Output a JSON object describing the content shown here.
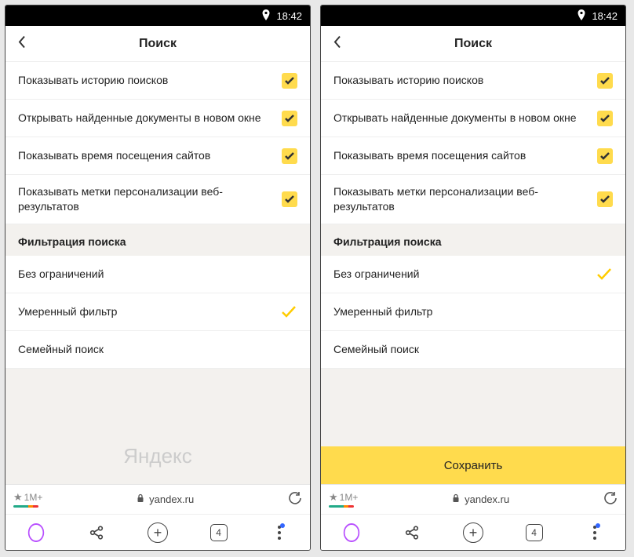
{
  "status": {
    "time": "18:42"
  },
  "header": {
    "title": "Поиск"
  },
  "options": [
    {
      "label": "Показывать историю поисков",
      "checked": true
    },
    {
      "label": "Открывать найденные документы в новом окне",
      "checked": true
    },
    {
      "label": "Показывать время посещения сайтов",
      "checked": true
    },
    {
      "label": "Показывать метки персонализации веб-результатов",
      "checked": true
    }
  ],
  "filter": {
    "title": "Фильтрация поиска",
    "items": [
      {
        "label": "Без ограничений"
      },
      {
        "label": "Умеренный фильтр"
      },
      {
        "label": "Семейный поиск"
      }
    ]
  },
  "screens": {
    "left": {
      "selected_filter_index": 1,
      "footer_kind": "brand",
      "brand": "Яндекс"
    },
    "right": {
      "selected_filter_index": 0,
      "footer_kind": "save",
      "save_label": "Сохранить"
    }
  },
  "urlbar": {
    "rating": "1M+",
    "domain": "yandex.ru"
  },
  "navbar": {
    "tab_count": "4"
  }
}
